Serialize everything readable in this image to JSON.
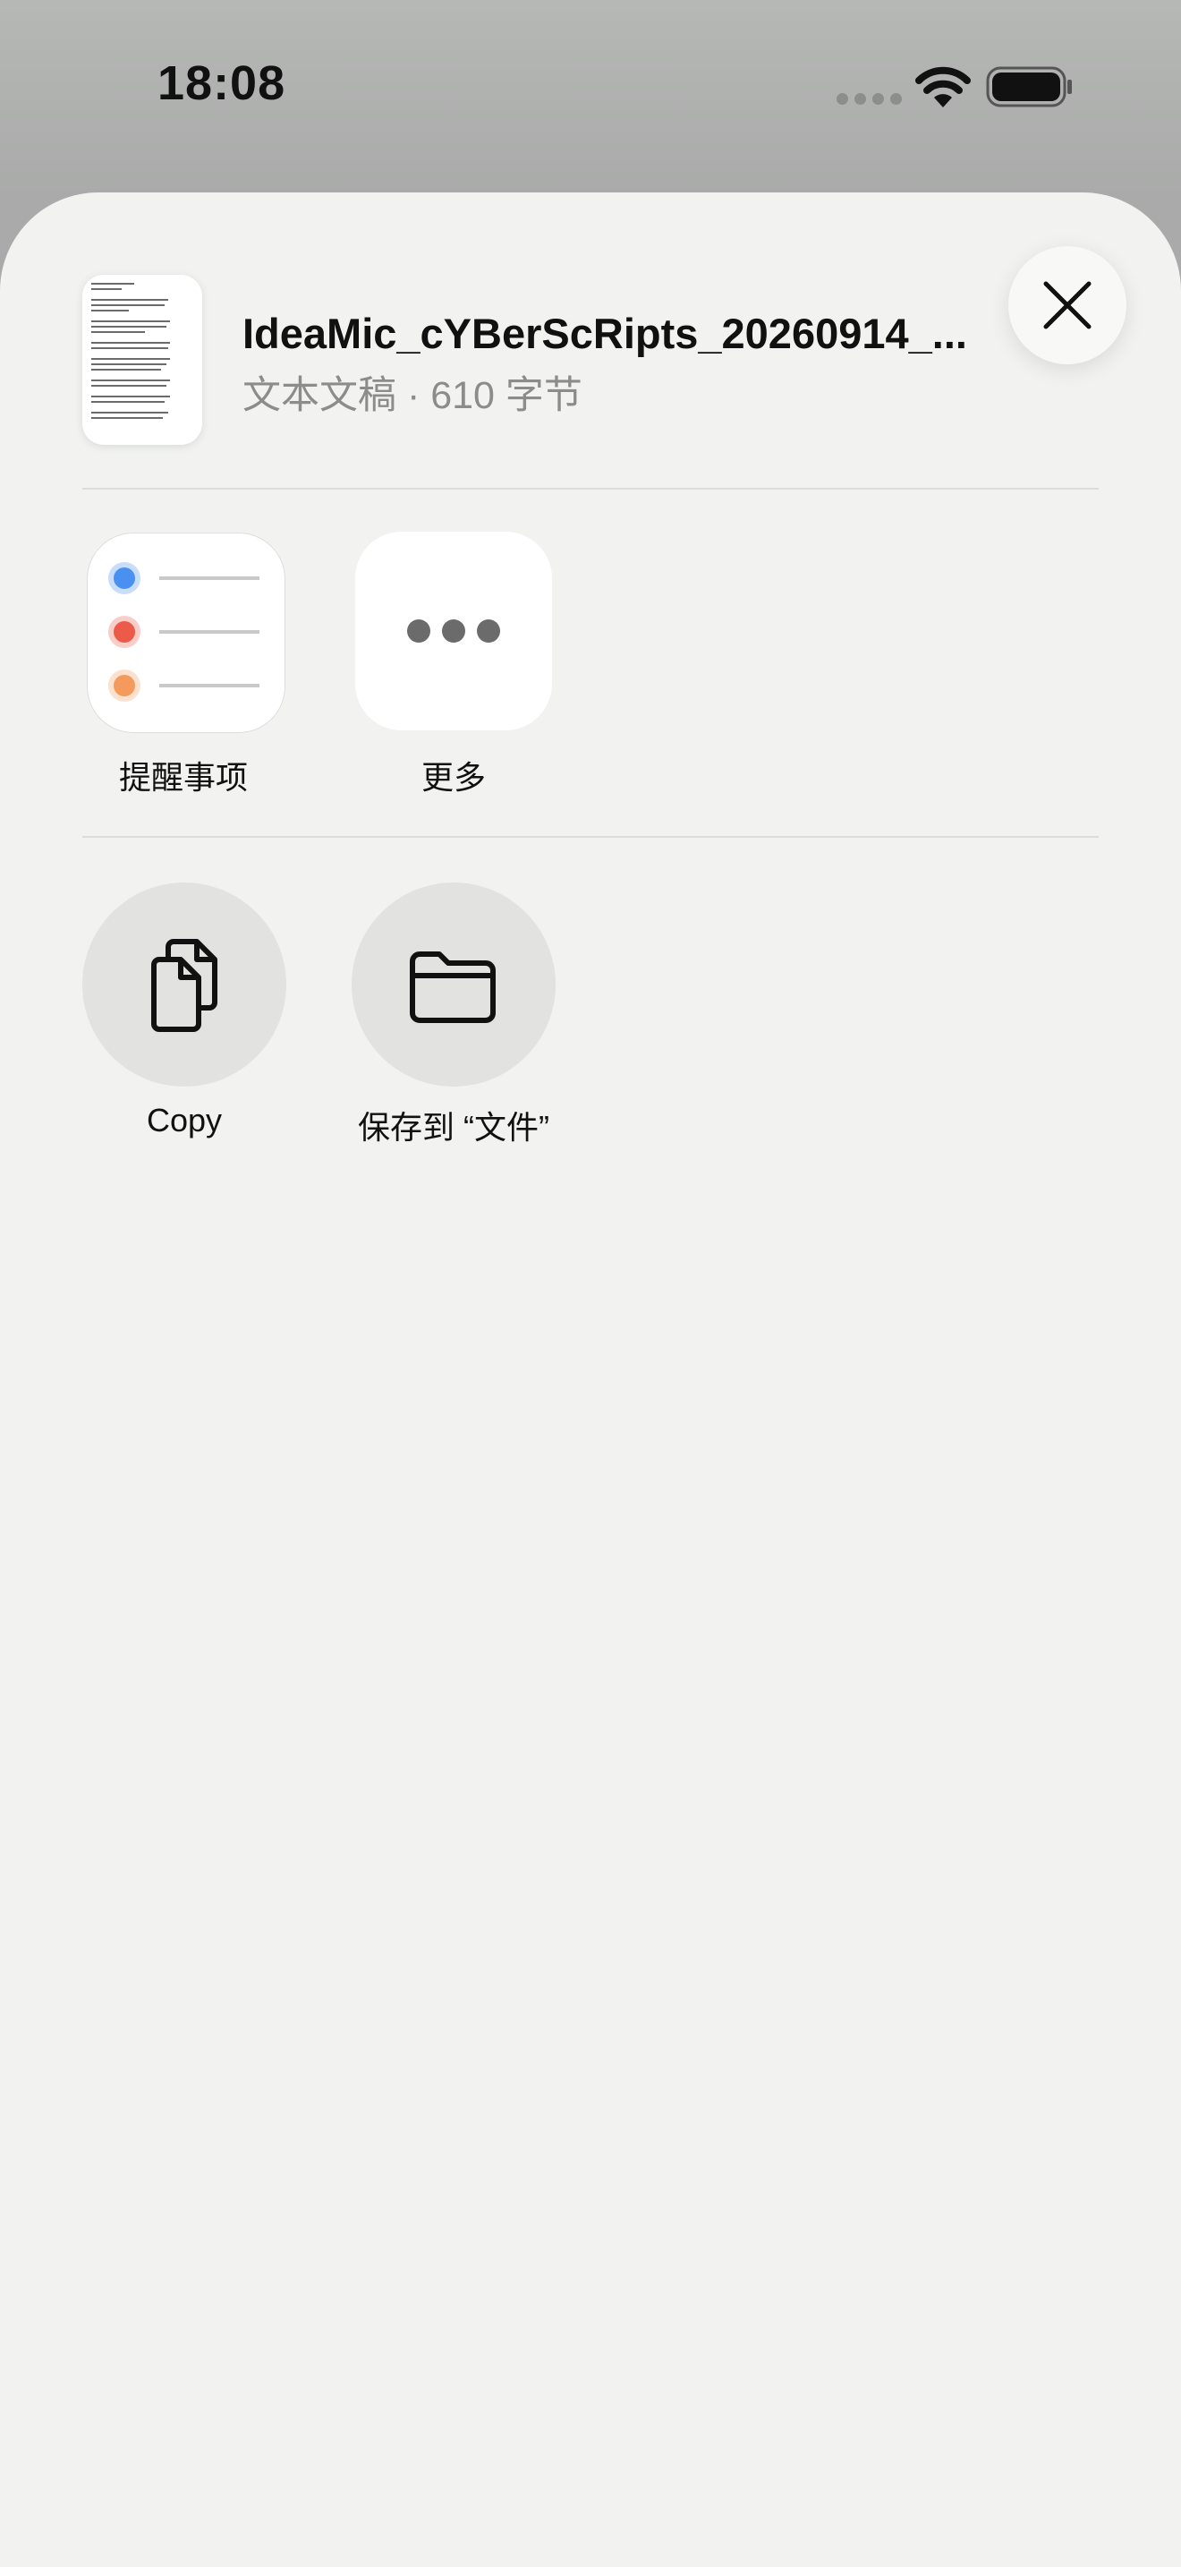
{
  "status_bar": {
    "time": "18:08",
    "icons": [
      "cellular-signal-icon",
      "wifi-icon",
      "battery-icon"
    ]
  },
  "share_header": {
    "file_name": "IdeaMic_cYBerScRipts_20260914_...",
    "file_meta": "文本文稿 · 610 字节",
    "close_icon": "close-icon"
  },
  "apps": [
    {
      "label": "提醒事项",
      "icon": "reminders-app-icon"
    },
    {
      "label": "更多",
      "icon": "more-ellipsis-icon"
    }
  ],
  "actions": [
    {
      "label": "Copy",
      "icon": "copy-documents-icon"
    },
    {
      "label": "保存到 “文件”",
      "icon": "folder-icon"
    }
  ],
  "colors": {
    "sheet_background": "#f2f3f1",
    "reminder_blue": "#4a90f0",
    "reminder_red": "#ec5a4a",
    "reminder_orange": "#f39a5c"
  }
}
